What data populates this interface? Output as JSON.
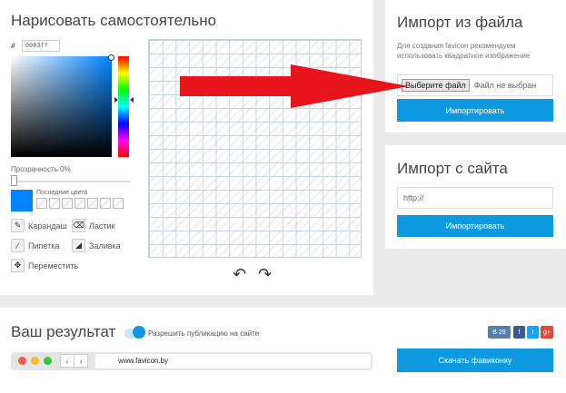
{
  "draw": {
    "title": "Нарисовать самостоятельно",
    "hex_prefix": "#",
    "hex_value": "0083ff",
    "current_color": "#0083ff",
    "opacity_label": "Прозрачность 0%",
    "recent_label": "Последние цвета",
    "tools": [
      {
        "label": "Карандаш",
        "icon": "pencil-icon"
      },
      {
        "label": "Ластик",
        "icon": "eraser-icon"
      },
      {
        "label": "Пипетка",
        "icon": "eyedropper-icon"
      },
      {
        "label": "Заливка",
        "icon": "fill-icon"
      },
      {
        "label": "Переместить",
        "icon": "move-icon"
      }
    ],
    "undo_icon": "↶",
    "redo_icon": "↷"
  },
  "import_file": {
    "title": "Импорт из файла",
    "description": "Для создания favicon рекомендуем использовать квадратное изображение",
    "choose_button": "Выберите файл",
    "no_file_text": "Файл не выбран",
    "import_button": "Импортировать"
  },
  "import_site": {
    "title": "Импорт с сайта",
    "url_value": "http://",
    "import_button": "Импортировать"
  },
  "result": {
    "title": "Ваш результат",
    "publish_label": "Разрешить публикацию на сайте",
    "share": {
      "vk_label": "В",
      "vk_count": "28",
      "facebook": "f",
      "twitter": "t",
      "gplus": "g+"
    },
    "back_glyph": "‹",
    "forward_glyph": "›",
    "address": "www.favicon.by",
    "download_button": "Скачать фавиконку"
  },
  "colors": {
    "accent": "#0d99e0",
    "arrow": "#e8141b"
  }
}
